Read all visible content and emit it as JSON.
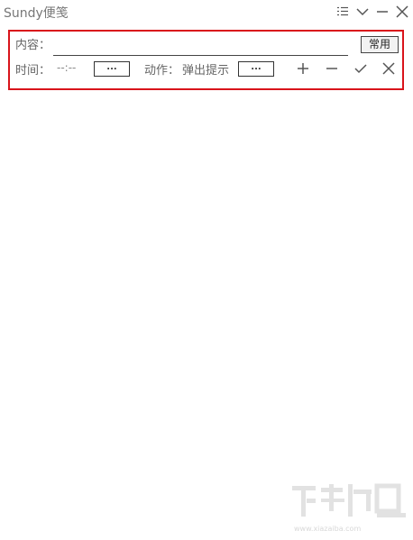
{
  "window": {
    "title": "Sundy便笺",
    "controls": [
      "list-icon",
      "chevron-down-icon",
      "minimize-icon",
      "close-icon"
    ]
  },
  "note_form": {
    "content_label": "内容：",
    "content_value": "",
    "common_button": "常用",
    "time_label": "时间：",
    "time_value": "--:--",
    "time_picker_button": "...",
    "action_label": "动作：",
    "action_value": "弹出提示",
    "action_picker_button": "...",
    "actions": [
      "plus-icon",
      "minus-icon",
      "check-icon",
      "close-icon"
    ]
  },
  "colors": {
    "highlight_border": "#d9141b",
    "text": "#666666"
  }
}
